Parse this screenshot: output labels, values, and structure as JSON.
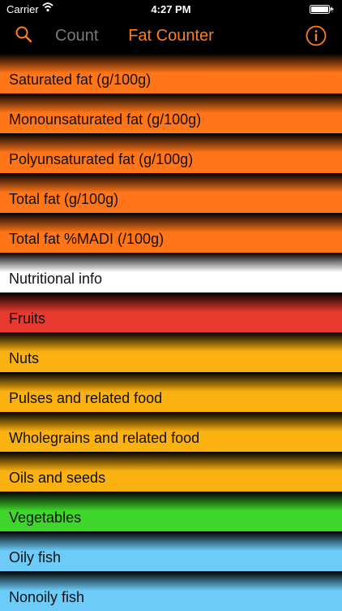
{
  "status_bar": {
    "carrier": "Carrier",
    "time": "4:27 PM"
  },
  "nav": {
    "count_label": "Count",
    "title": "Fat Counter",
    "search_icon": "search-icon",
    "info_icon": "info-icon"
  },
  "rows": [
    {
      "label": "Saturated fat (g/100g)",
      "color": "#ff7518"
    },
    {
      "label": "Monounsaturated fat (g/100g)",
      "color": "#ff7518"
    },
    {
      "label": "Polyunsaturated fat (g/100g)",
      "color": "#ff7518"
    },
    {
      "label": "Total fat (g/100g)",
      "color": "#ff7518"
    },
    {
      "label": "Total fat %MADI (/100g)",
      "color": "#ff7518"
    },
    {
      "label": "Nutritional info",
      "color": "#ffffff"
    },
    {
      "label": "Fruits",
      "color": "#e8392e"
    },
    {
      "label": "Nuts",
      "color": "#fbb10f"
    },
    {
      "label": "Pulses and related food",
      "color": "#fbb10f"
    },
    {
      "label": "Wholegrains and related food",
      "color": "#fbb10f"
    },
    {
      "label": "Oils and seeds",
      "color": "#fbb10f"
    },
    {
      "label": "Vegetables",
      "color": "#3fd62b"
    },
    {
      "label": "Oily fish",
      "color": "#6ccbf7"
    },
    {
      "label": "Nonoily fish",
      "color": "#6ccbf7"
    }
  ]
}
